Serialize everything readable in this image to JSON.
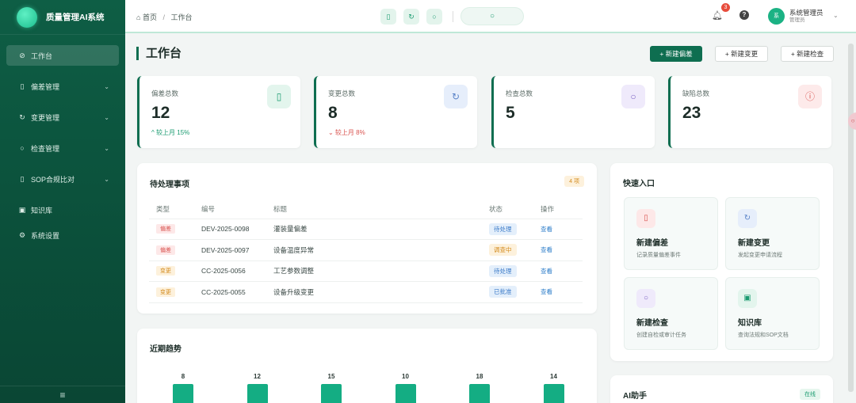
{
  "app": {
    "title": "质量管理AI系统"
  },
  "sidebar": {
    "items": [
      {
        "label": "工作台",
        "icon": "dashboard-icon",
        "active": true,
        "has_children": false
      },
      {
        "label": "偏差管理",
        "icon": "file-icon",
        "active": false,
        "has_children": true
      },
      {
        "label": "变更管理",
        "icon": "refresh-icon",
        "active": false,
        "has_children": true
      },
      {
        "label": "检查管理",
        "icon": "search-icon",
        "active": false,
        "has_children": true
      },
      {
        "label": "SOP合规比对",
        "icon": "document-icon",
        "active": false,
        "has_children": true
      },
      {
        "label": "知识库",
        "icon": "book-icon",
        "active": false,
        "has_children": false
      },
      {
        "label": "系统设置",
        "icon": "gear-icon",
        "active": false,
        "has_children": false
      }
    ],
    "collapse_glyph": "≡"
  },
  "topbar": {
    "breadcrumb": {
      "home": "首页",
      "separator": "/",
      "current": "工作台"
    },
    "notification_count": "3",
    "user": {
      "name": "系统管理员",
      "role": "管理员",
      "avatar_text": "系"
    }
  },
  "page": {
    "title": "工作台",
    "buttons": {
      "new_deviation": "+ 新建偏差",
      "new_change": "+ 新建变更",
      "new_inspection": "+ 新建检查"
    }
  },
  "stats": [
    {
      "label": "偏差总数",
      "value": "12",
      "trend": "^ 较上月 15%",
      "trend_color": "#1a9b70",
      "icon": "file-icon",
      "icon_bg": "#e3f5ed",
      "icon_color": "#1a9b70"
    },
    {
      "label": "变更总数",
      "value": "8",
      "trend": "⌄ 较上月 8%",
      "trend_color": "#d9534f",
      "icon": "refresh-icon",
      "icon_bg": "#e6eefb",
      "icon_color": "#5b84c8"
    },
    {
      "label": "检查总数",
      "value": "5",
      "trend": "",
      "trend_color": "#1a9b70",
      "icon": "search-icon",
      "icon_bg": "#efeafb",
      "icon_color": "#7c62c4"
    },
    {
      "label": "缺陷总数",
      "value": "23",
      "trend": "",
      "trend_color": "#1a9b70",
      "icon": "alert-icon",
      "icon_bg": "#fdeaea",
      "icon_color": "#d9534f"
    }
  ],
  "pending": {
    "title": "待处理事项",
    "count_badge": "4 项",
    "columns": [
      "类型",
      "编号",
      "标题",
      "状态",
      "操作"
    ],
    "rows": [
      {
        "type": "偏差",
        "type_bg": "#fde8e8",
        "type_color": "#d9534f",
        "code": "DEV-2025-0098",
        "title": "灌装量偏差",
        "status": "待处理",
        "status_bg": "#e4effb",
        "status_color": "#3d7cc9",
        "action": "查看"
      },
      {
        "type": "偏差",
        "type_bg": "#fde8e8",
        "type_color": "#d9534f",
        "code": "DEV-2025-0097",
        "title": "设备温度异常",
        "status": "调查中",
        "status_bg": "#fdf1dc",
        "status_color": "#d38a1c",
        "action": "查看"
      },
      {
        "type": "变更",
        "type_bg": "#fdf1dc",
        "type_color": "#d38a1c",
        "code": "CC-2025-0056",
        "title": "工艺参数调整",
        "status": "待处理",
        "status_bg": "#e4effb",
        "status_color": "#3d7cc9",
        "action": "查看"
      },
      {
        "type": "变更",
        "type_bg": "#fdf1dc",
        "type_color": "#d38a1c",
        "code": "CC-2025-0055",
        "title": "设备升级变更",
        "status": "已批准",
        "status_bg": "#e4effb",
        "status_color": "#3d7cc9",
        "action": "查看"
      }
    ]
  },
  "trend": {
    "title": "近期趋势"
  },
  "chart_data": {
    "type": "bar",
    "values": [
      8,
      12,
      15,
      10,
      18,
      14
    ],
    "title": "近期趋势"
  },
  "quick": {
    "title": "快速入口",
    "items": [
      {
        "title": "新建偏差",
        "desc": "记录质量偏差事件",
        "icon": "file-icon",
        "icon_bg": "#fde8e8",
        "icon_color": "#d9534f"
      },
      {
        "title": "新建变更",
        "desc": "发起变更申请流程",
        "icon": "refresh-icon",
        "icon_bg": "#e6eefb",
        "icon_color": "#5b84c8"
      },
      {
        "title": "新建检查",
        "desc": "创建自检或审计任务",
        "icon": "search-icon",
        "icon_bg": "#efeafb",
        "icon_color": "#7c62c4"
      },
      {
        "title": "知识库",
        "desc": "查询法规和SOP文档",
        "icon": "book-icon",
        "icon_bg": "#e3f5ed",
        "icon_color": "#1a9b70"
      }
    ]
  },
  "assistant": {
    "title": "AI助手",
    "status": "在线"
  }
}
